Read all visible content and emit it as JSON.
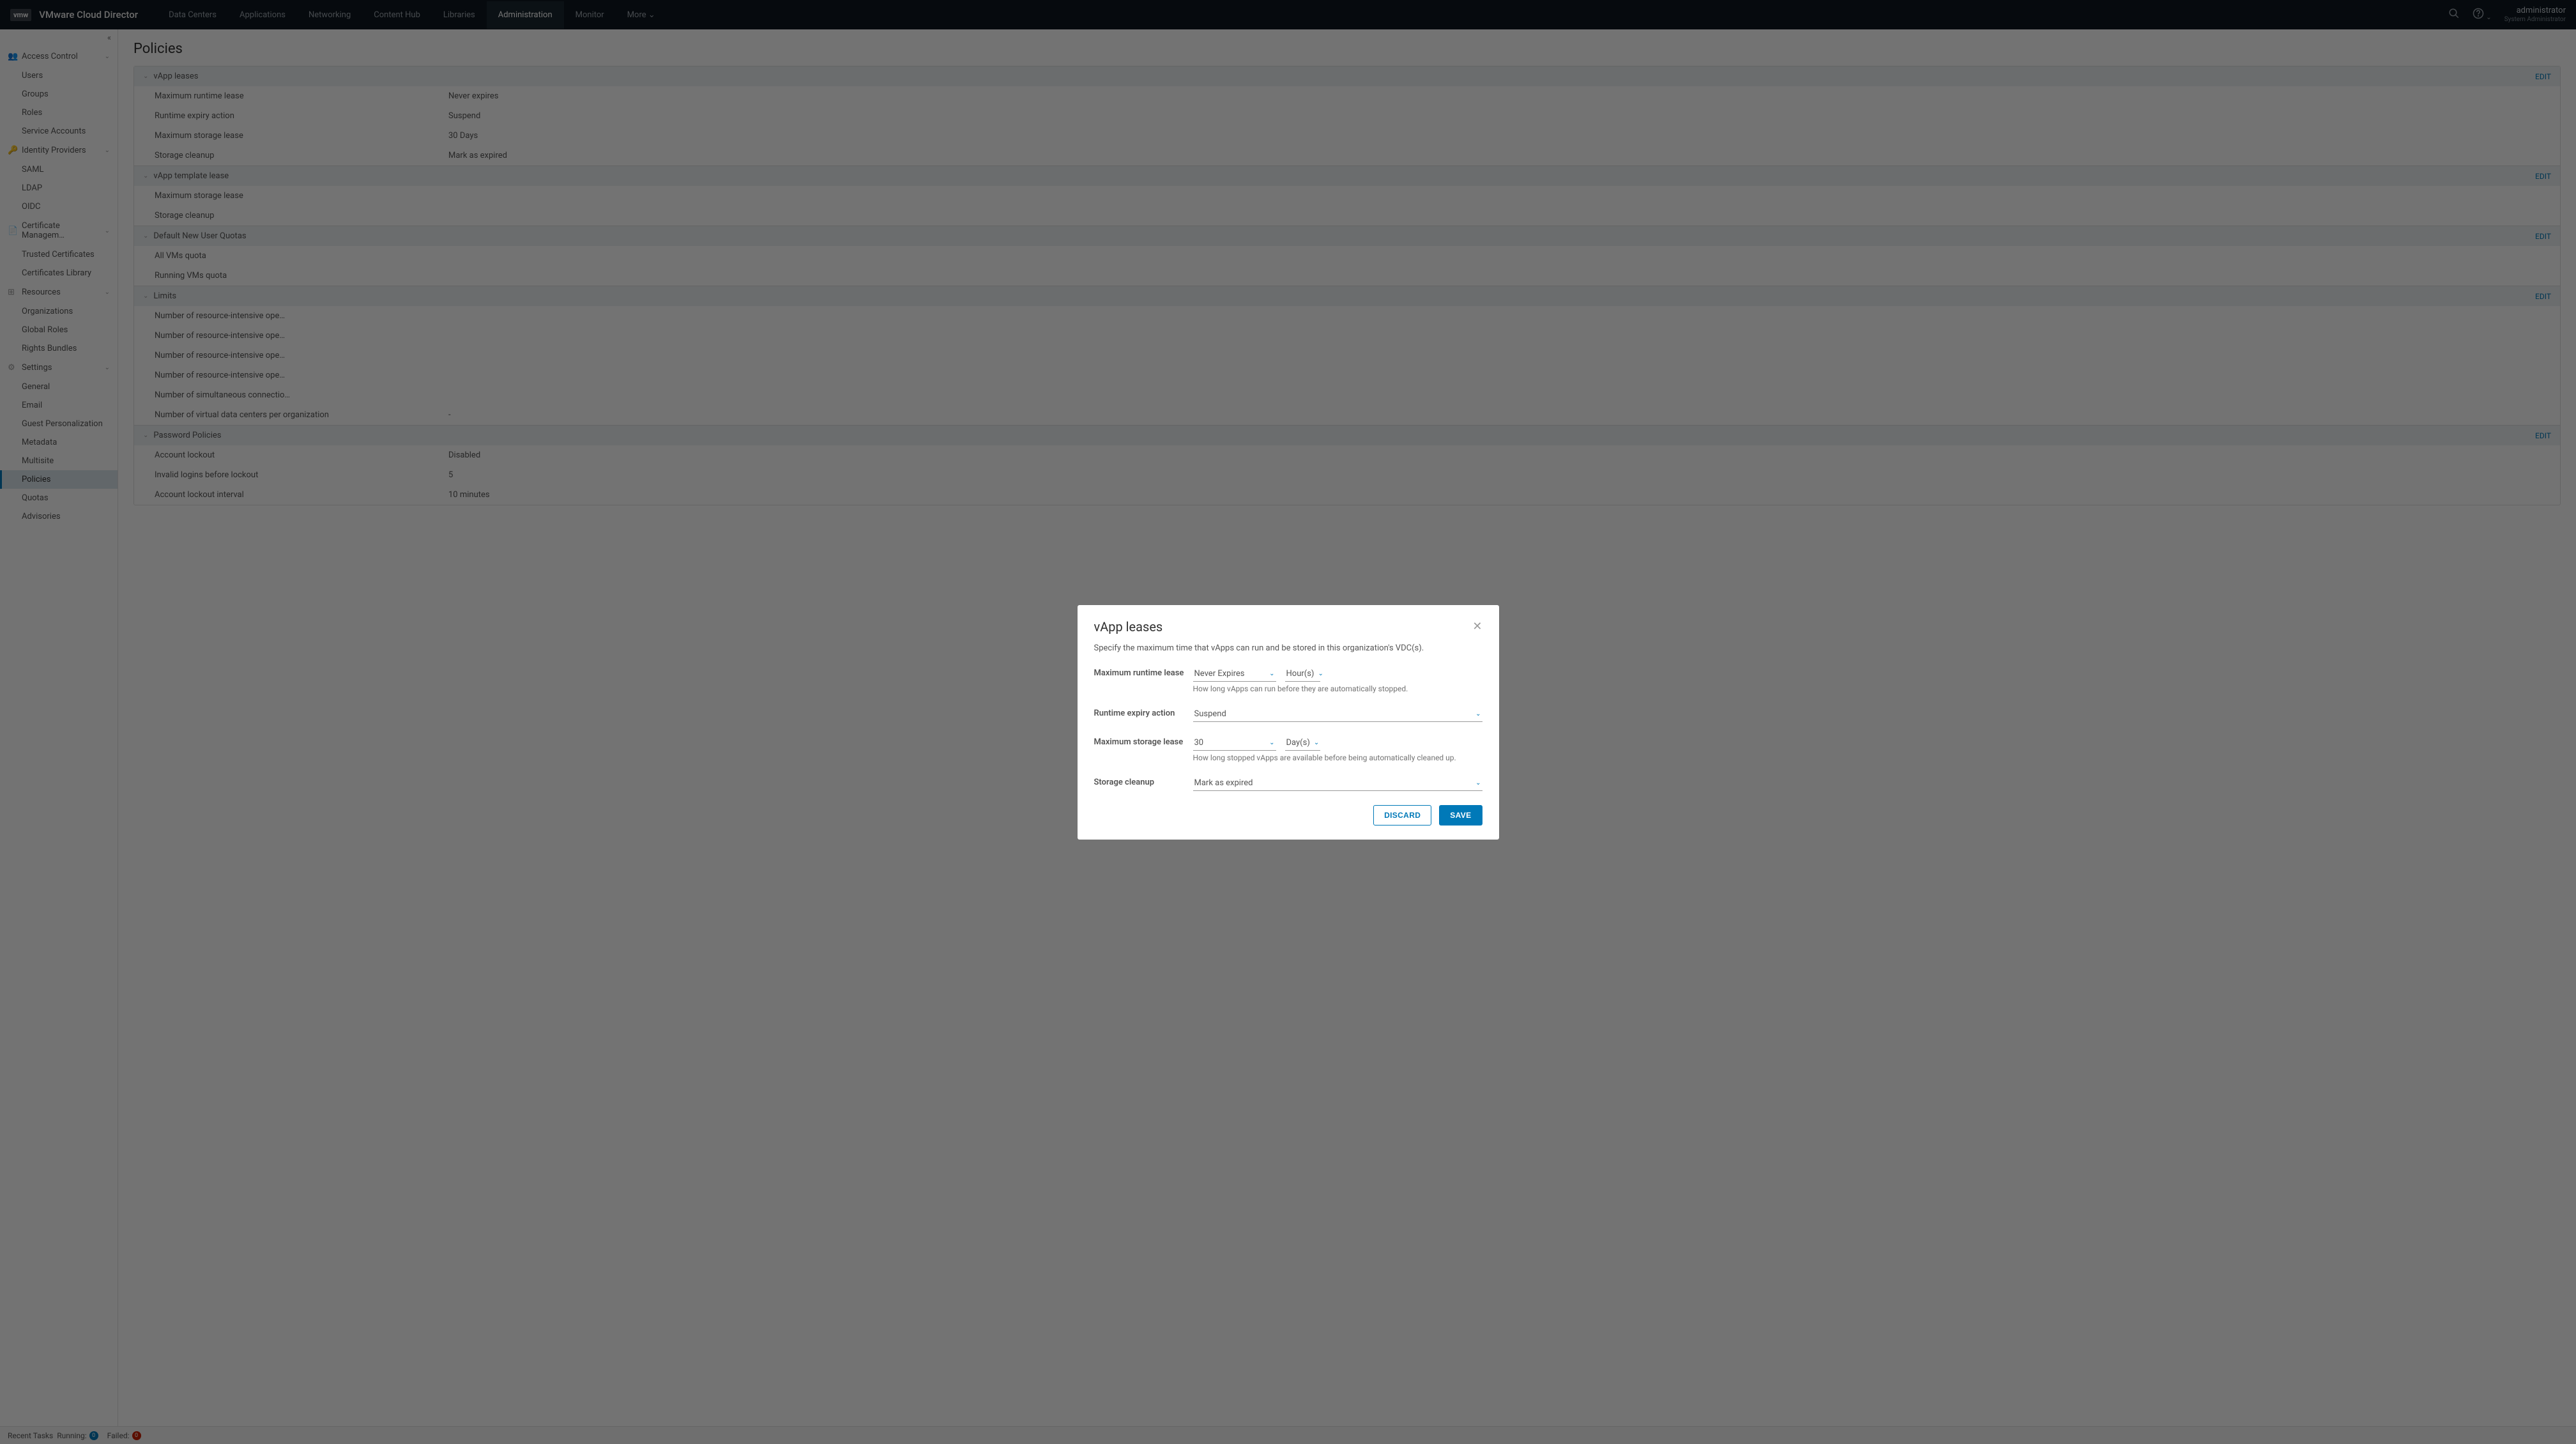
{
  "brand": {
    "logo": "vmw",
    "name": "VMware Cloud Director"
  },
  "nav": {
    "items": [
      "Data Centers",
      "Applications",
      "Networking",
      "Content Hub",
      "Libraries",
      "Administration",
      "Monitor",
      "More"
    ],
    "active": 5,
    "more_chev": "⌄"
  },
  "user": {
    "name": "administrator",
    "role": "System Administrator"
  },
  "sidebar": {
    "collapse": "«",
    "sections": [
      {
        "title": "Access Control",
        "items": [
          "Users",
          "Groups",
          "Roles",
          "Service Accounts"
        ]
      },
      {
        "title": "Identity Providers",
        "items": [
          "SAML",
          "LDAP",
          "OIDC"
        ]
      },
      {
        "title": "Certificate Managem…",
        "items": [
          "Trusted Certificates",
          "Certificates Library"
        ]
      },
      {
        "title": "Resources",
        "items": [
          "Organizations",
          "Global Roles",
          "Rights Bundles"
        ]
      },
      {
        "title": "Settings",
        "items": [
          "General",
          "Email",
          "Guest Personalization",
          "Metadata",
          "Multisite",
          "Policies",
          "Quotas",
          "Advisories"
        ]
      }
    ],
    "active": {
      "section": 4,
      "item": 5
    }
  },
  "page": {
    "title": "Policies",
    "groups": [
      {
        "title": "vApp leases",
        "edit": "EDIT",
        "rows": [
          {
            "k": "Maximum runtime lease",
            "v": "Never expires"
          },
          {
            "k": "Runtime expiry action",
            "v": "Suspend"
          },
          {
            "k": "Maximum storage lease",
            "v": "30 Days"
          },
          {
            "k": "Storage cleanup",
            "v": "Mark as expired"
          }
        ]
      },
      {
        "title": "vApp template lease",
        "edit": "EDIT",
        "rows": [
          {
            "k": "Maximum storage lease",
            "v": ""
          },
          {
            "k": "Storage cleanup",
            "v": ""
          }
        ]
      },
      {
        "title": "Default New User Quotas",
        "edit": "EDIT",
        "rows": [
          {
            "k": "All VMs quota",
            "v": ""
          },
          {
            "k": "Running VMs quota",
            "v": ""
          }
        ]
      },
      {
        "title": "Limits",
        "edit": "EDIT",
        "rows": [
          {
            "k": "Number of resource-intensive ope…",
            "v": ""
          },
          {
            "k": "Number of resource-intensive ope…",
            "v": ""
          },
          {
            "k": "Number of resource-intensive ope…",
            "v": ""
          },
          {
            "k": "Number of resource-intensive ope…",
            "v": ""
          },
          {
            "k": "Number of simultaneous connectio…",
            "v": ""
          },
          {
            "k": "Number of virtual data centers per organization",
            "v": "-"
          }
        ]
      },
      {
        "title": "Password Policies",
        "edit": "EDIT",
        "rows": [
          {
            "k": "Account lockout",
            "v": "Disabled"
          },
          {
            "k": "Invalid logins before lockout",
            "v": "5"
          },
          {
            "k": "Account lockout interval",
            "v": "10 minutes"
          }
        ]
      }
    ]
  },
  "footer": {
    "recent": "Recent Tasks",
    "running_lbl": "Running:",
    "running_n": "0",
    "failed_lbl": "Failed:",
    "failed_n": "0"
  },
  "modal": {
    "title": "vApp leases",
    "desc": "Specify the maximum time that vApps can run and be stored in this organization's VDC(s).",
    "fields": {
      "max_runtime": {
        "label": "Maximum runtime lease",
        "value": "Never Expires",
        "unit": "Hour(s)",
        "hint": "How long vApps can run before they are automatically stopped."
      },
      "runtime_action": {
        "label": "Runtime expiry action",
        "value": "Suspend"
      },
      "max_storage": {
        "label": "Maximum storage lease",
        "value": "30",
        "unit": "Day(s)",
        "hint": "How long stopped vApps are available before being automatically cleaned up."
      },
      "storage_cleanup": {
        "label": "Storage cleanup",
        "value": "Mark as expired"
      }
    },
    "discard": "DISCARD",
    "save": "SAVE"
  }
}
